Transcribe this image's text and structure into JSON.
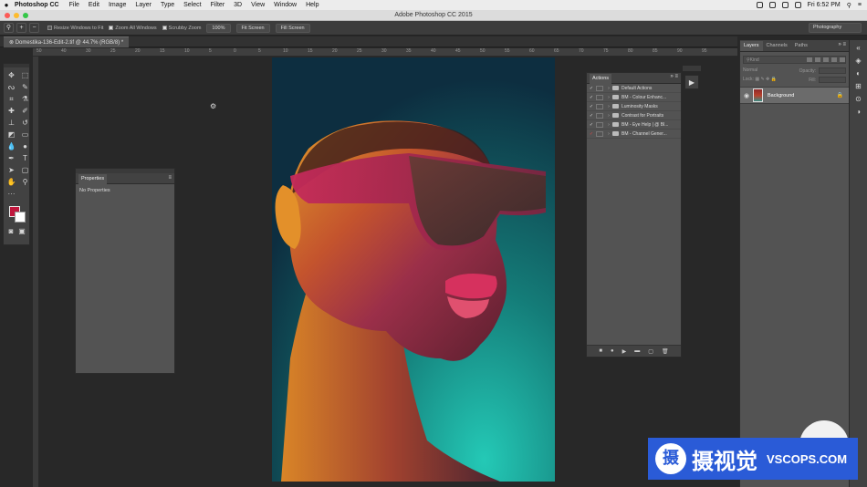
{
  "menubar": {
    "app": "Photoshop CC",
    "items": [
      "File",
      "Edit",
      "Image",
      "Layer",
      "Type",
      "Select",
      "Filter",
      "3D",
      "View",
      "Window",
      "Help"
    ],
    "clock": "Fri 6:52 PM"
  },
  "window": {
    "title": "Adobe Photoshop CC 2015"
  },
  "options": {
    "zoom_in": "+",
    "zoom_out": "−",
    "resize_windows": "Resize Windows to Fit",
    "zoom_all": "Zoom All Windows",
    "scrubby": "Scrubby Zoom",
    "pct_button": "100%",
    "fit_screen": "Fit Screen",
    "fill_screen": "Fill Screen",
    "workspace": "Photography"
  },
  "document": {
    "tab_label": "Domestika-136-Edit-2.tif @ 44.7% (RGB/8) *"
  },
  "ruler": {
    "ticks": [
      "50",
      "40",
      "30",
      "25",
      "20",
      "15",
      "10",
      "5",
      "0",
      "5",
      "10",
      "15",
      "20",
      "25",
      "30",
      "35",
      "40",
      "45",
      "50",
      "55",
      "60",
      "65",
      "70",
      "75",
      "80",
      "85",
      "90",
      "95"
    ]
  },
  "properties": {
    "tab": "Properties",
    "empty": "No Properties"
  },
  "actions": {
    "tab": "Actions",
    "items": [
      {
        "label": "Default Actions",
        "check": "✓",
        "red": false
      },
      {
        "label": "BM - Colour Enhanc...",
        "check": "✓",
        "red": false
      },
      {
        "label": "Luminosity Masks",
        "check": "✓",
        "red": false
      },
      {
        "label": "Contrast for Portraits",
        "check": "✓",
        "red": false
      },
      {
        "label": "BM - Eye Help | @ Bl...",
        "check": "✓",
        "red": false
      },
      {
        "label": "BM - Channel Gener...",
        "check": "✓",
        "red": true
      }
    ]
  },
  "layers": {
    "tabs": [
      "Layers",
      "Channels",
      "Paths"
    ],
    "filter": "Kind",
    "blend": "Normal",
    "opacity_label": "Opacity:",
    "lock_label": "Lock:",
    "fill_label": "Fill:",
    "layer_name": "Background"
  },
  "watermark": {
    "cn": "摄视觉",
    "en": "VSCOPS.COM",
    "badge": "摄"
  },
  "colors": {
    "foreground": "#c0173d",
    "background": "#ffffff",
    "accent": "#2a5bd7"
  }
}
